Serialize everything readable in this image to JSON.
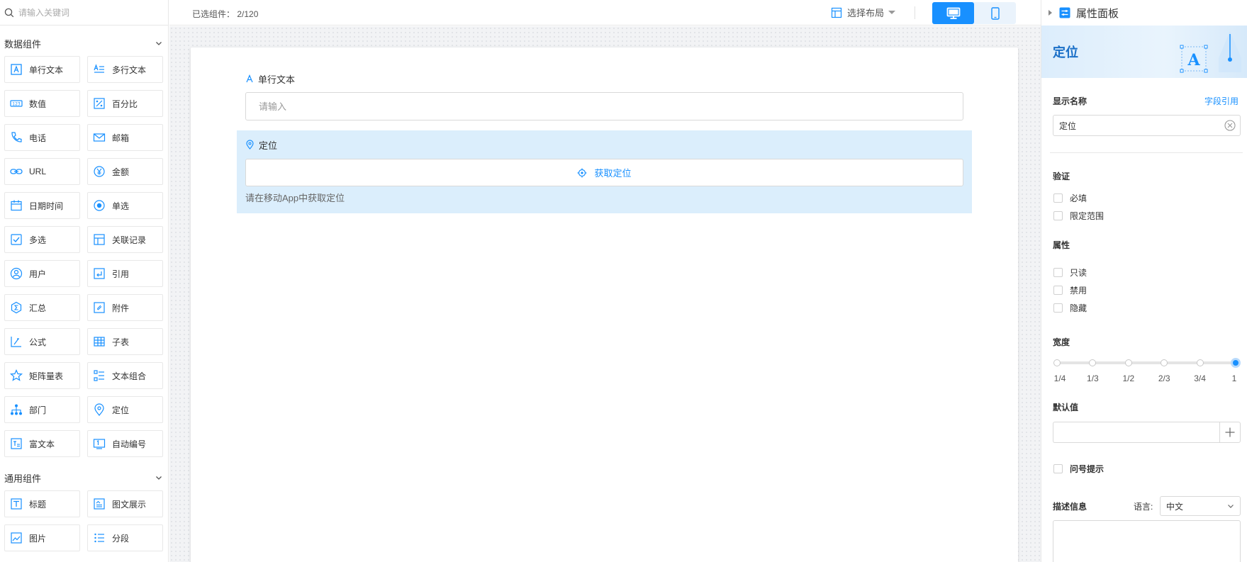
{
  "search": {
    "placeholder": "请输入关键词"
  },
  "groups": {
    "data": {
      "title": "数据组件"
    },
    "common": {
      "title": "通用组件"
    }
  },
  "data_components": [
    {
      "label": "单行文本",
      "icon": "text-a-icon"
    },
    {
      "label": "多行文本",
      "icon": "multiline-text-icon"
    },
    {
      "label": "数值",
      "icon": "number-icon"
    },
    {
      "label": "百分比",
      "icon": "percent-icon"
    },
    {
      "label": "电话",
      "icon": "phone-icon"
    },
    {
      "label": "邮箱",
      "icon": "mail-icon"
    },
    {
      "label": "URL",
      "icon": "link-icon"
    },
    {
      "label": "金额",
      "icon": "yen-icon"
    },
    {
      "label": "日期时间",
      "icon": "calendar-icon"
    },
    {
      "label": "单选",
      "icon": "radio-icon"
    },
    {
      "label": "多选",
      "icon": "checkbox-icon"
    },
    {
      "label": "关联记录",
      "icon": "relation-icon"
    },
    {
      "label": "用户",
      "icon": "user-icon"
    },
    {
      "label": "引用",
      "icon": "reference-icon"
    },
    {
      "label": "汇总",
      "icon": "summary-icon"
    },
    {
      "label": "附件",
      "icon": "attachment-icon"
    },
    {
      "label": "公式",
      "icon": "formula-icon"
    },
    {
      "label": "子表",
      "icon": "subtable-icon"
    },
    {
      "label": "矩阵量表",
      "icon": "star-icon"
    },
    {
      "label": "文本组合",
      "icon": "text-combine-icon"
    },
    {
      "label": "部门",
      "icon": "org-chart-icon"
    },
    {
      "label": "定位",
      "icon": "location-pin-icon"
    },
    {
      "label": "富文本",
      "icon": "rich-text-icon"
    },
    {
      "label": "自动编号",
      "icon": "auto-number-icon"
    }
  ],
  "common_components": [
    {
      "label": "标题",
      "icon": "title-t-icon"
    },
    {
      "label": "图文展示",
      "icon": "image-text-icon"
    },
    {
      "label": "图片",
      "icon": "image-icon"
    },
    {
      "label": "分段",
      "icon": "section-list-icon"
    }
  ],
  "topbar": {
    "selected_label": "已选组件：",
    "selected_count": "2/120",
    "layout_label": "选择布局"
  },
  "form": {
    "field1": {
      "label": "单行文本",
      "placeholder": "请输入"
    },
    "field2": {
      "label": "定位",
      "button": "获取定位",
      "hint": "请在移动App中获取定位"
    }
  },
  "panel": {
    "title": "属性面板",
    "banner_title": "定位",
    "display_name_label": "显示名称",
    "field_ref_link": "字段引用",
    "display_name_value": "定位",
    "validation_title": "验证",
    "validation": [
      "必填",
      "限定范围"
    ],
    "properties_title": "属性",
    "properties": [
      "只读",
      "禁用",
      "隐藏"
    ],
    "width_title": "宽度",
    "width_ticks": [
      "1/4",
      "1/3",
      "1/2",
      "2/3",
      "3/4",
      "1"
    ],
    "width_selected": "1",
    "default_title": "默认值",
    "tooltip_label": "问号提示",
    "desc_title": "描述信息",
    "lang_label": "语言:",
    "lang_value": "中文"
  },
  "colors": {
    "accent": "#1890ff",
    "selected_bg": "#dbeefc"
  }
}
